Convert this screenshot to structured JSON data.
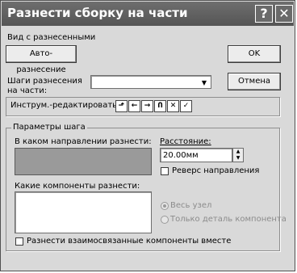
{
  "title": "Разнести сборку на части",
  "titlebar": {
    "help_label": "?",
    "close_label": "✕"
  },
  "view_label": "Вид с разнесенными",
  "auto_button": "Авто-разнесение",
  "ok_button": "OK",
  "cancel_button": "Отмена",
  "steps_label_line1": "Шаги разнесения",
  "steps_label_line2": "на части:",
  "steps_value": "",
  "tools_label": "Инструм.-редактировать:",
  "tools": [
    "step-icon",
    "arrow-left-icon",
    "arrow-right-icon",
    "undo-icon",
    "delete-icon",
    "accept-icon"
  ],
  "tool_glyphs": {
    "step-icon": "⬏",
    "arrow-left-icon": "←",
    "arrow-right-icon": "→",
    "undo-icon": "Ո",
    "delete-icon": "✕",
    "accept-icon": "✓"
  },
  "group_caption": "Параметры шага",
  "direction_label": "В каком направлении разнести:",
  "distance_label": "Расстояние:",
  "distance_value": "20.00мм",
  "spin_up": "▲",
  "spin_down": "▼",
  "reverse_label": "Реверс направления",
  "components_label": "Какие компоненты разнести:",
  "radio_whole": "Весь узел",
  "radio_part": "Только деталь компонента",
  "together_label": "Разнести взаимосвязанные компоненты вместе",
  "combo_arrow": "▼"
}
